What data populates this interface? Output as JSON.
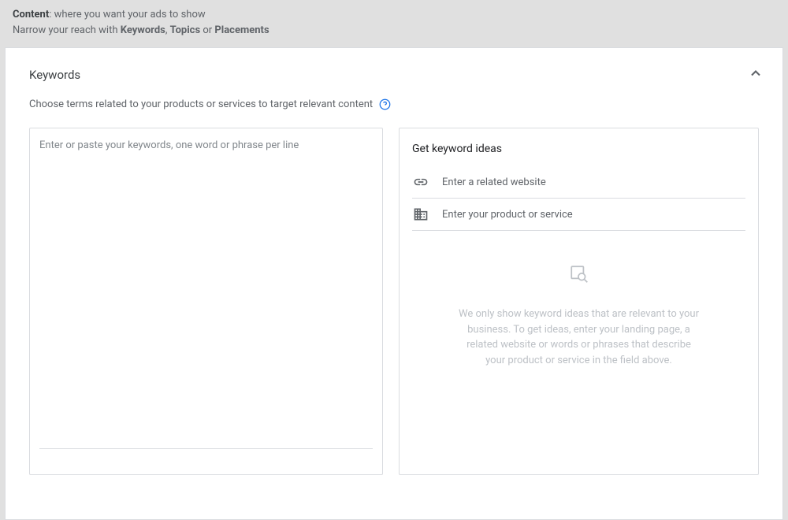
{
  "header": {
    "title_bold": "Content",
    "title_rest": ": where you want your ads to show",
    "subtitle_prefix": "Narrow your reach with ",
    "subtitle_keywords": "Keywords",
    "subtitle_sep1": ", ",
    "subtitle_topics": "Topics",
    "subtitle_sep2": " or ",
    "subtitle_placements": "Placements"
  },
  "section": {
    "title": "Keywords",
    "description": "Choose terms related to your products or services to target relevant content"
  },
  "keywords": {
    "placeholder": "Enter or paste your keywords, one word or phrase per line"
  },
  "ideas": {
    "title": "Get keyword ideas",
    "website_placeholder": "Enter a related website",
    "product_placeholder": "Enter your product or service",
    "empty_message": "We only show keyword ideas that are relevant to your business. To get ideas, enter your landing page, a related website or words or phrases that describe your product or service in the field above."
  }
}
